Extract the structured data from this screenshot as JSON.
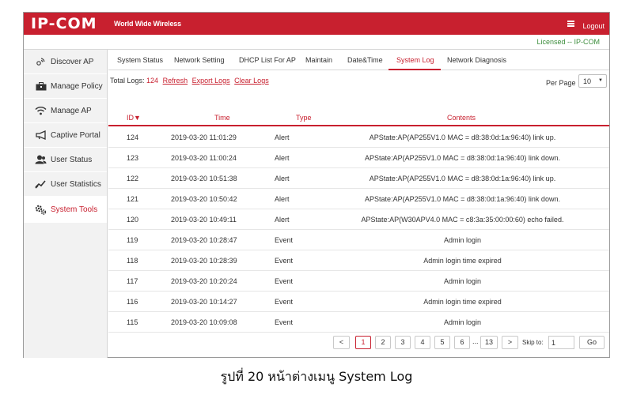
{
  "header": {
    "logo": "IP-COM",
    "tagline": "World Wide Wireless",
    "logout": "Logout",
    "licensed": "Licensed -- IP-COM"
  },
  "sidebar": {
    "items": [
      {
        "label": "Discover AP",
        "icon": "discover-ap-icon"
      },
      {
        "label": "Manage Policy",
        "icon": "manage-policy-icon"
      },
      {
        "label": "Manage AP",
        "icon": "wifi-icon"
      },
      {
        "label": "Captive Portal",
        "icon": "megaphone-icon"
      },
      {
        "label": "User Status",
        "icon": "users-icon"
      },
      {
        "label": "User Statistics",
        "icon": "chart-line-icon"
      },
      {
        "label": "System Tools",
        "icon": "gears-icon",
        "active": true
      }
    ]
  },
  "tabs": [
    {
      "label": "System Status"
    },
    {
      "label": "Network Setting"
    },
    {
      "label": "DHCP List For AP"
    },
    {
      "label": "Maintain"
    },
    {
      "label": "Date&Time"
    },
    {
      "label": "System Log",
      "active": true
    },
    {
      "label": "Network Diagnosis"
    }
  ],
  "log_bar": {
    "total_label": "Total Logs:",
    "total_count": "124",
    "refresh": "Refresh",
    "export": "Export Logs",
    "clear": "Clear Logs",
    "per_page_label": "Per Page",
    "per_page_value": "10"
  },
  "table": {
    "columns": {
      "id": "ID▼",
      "time": "Time",
      "type": "Type",
      "contents": "Contents"
    },
    "rows": [
      {
        "id": "124",
        "time": "2019-03-20 11:01:29",
        "type": "Alert",
        "contents": "APState:AP(AP255V1.0 MAC = d8:38:0d:1a:96:40) link up."
      },
      {
        "id": "123",
        "time": "2019-03-20 11:00:24",
        "type": "Alert",
        "contents": "APState:AP(AP255V1.0 MAC = d8:38:0d:1a:96:40) link down."
      },
      {
        "id": "122",
        "time": "2019-03-20 10:51:38",
        "type": "Alert",
        "contents": "APState:AP(AP255V1.0 MAC = d8:38:0d:1a:96:40) link up."
      },
      {
        "id": "121",
        "time": "2019-03-20 10:50:42",
        "type": "Alert",
        "contents": "APState:AP(AP255V1.0 MAC = d8:38:0d:1a:96:40) link down."
      },
      {
        "id": "120",
        "time": "2019-03-20 10:49:11",
        "type": "Alert",
        "contents": "APState:AP(W30APV4.0 MAC = c8:3a:35:00:00:60) echo failed."
      },
      {
        "id": "119",
        "time": "2019-03-20 10:28:47",
        "type": "Event",
        "contents": "Admin login"
      },
      {
        "id": "118",
        "time": "2019-03-20 10:28:39",
        "type": "Event",
        "contents": "Admin login time expired"
      },
      {
        "id": "117",
        "time": "2019-03-20 10:20:24",
        "type": "Event",
        "contents": "Admin login"
      },
      {
        "id": "116",
        "time": "2019-03-20 10:14:27",
        "type": "Event",
        "contents": "Admin login time expired"
      },
      {
        "id": "115",
        "time": "2019-03-20 10:09:08",
        "type": "Event",
        "contents": "Admin login"
      }
    ]
  },
  "pagination": {
    "prev": "<",
    "pages": [
      "1",
      "2",
      "3",
      "4",
      "5",
      "6"
    ],
    "current": "1",
    "ellipsis": "...",
    "last": "13",
    "next": ">",
    "skip_label": "Skip to:",
    "skip_value": "1",
    "go": "Go"
  },
  "caption": "รูปที่ 20 หน้าต่างเมนู System Log",
  "colors": {
    "brand": "#c8202f",
    "licensed_text": "#3c8d3c",
    "sidebar_bg": "#f2f2f2"
  }
}
